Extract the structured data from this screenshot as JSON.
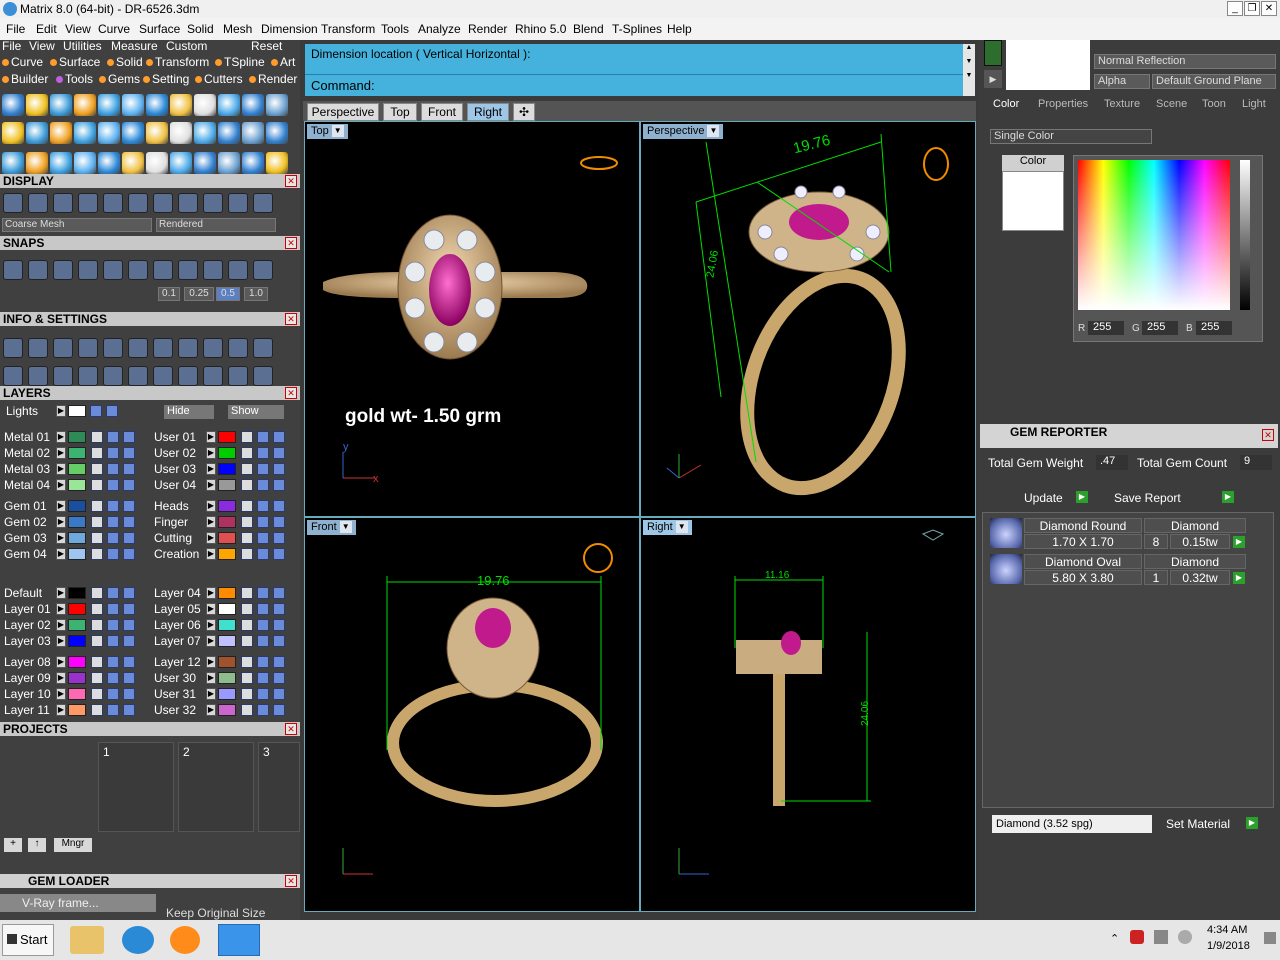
{
  "window": {
    "title": "Matrix 8.0 (64-bit) - DR-6526.3dm"
  },
  "menu": [
    "File",
    "Edit",
    "View",
    "Curve",
    "Surface",
    "Solid",
    "Mesh",
    "Dimension",
    "Transform",
    "Tools",
    "Analyze",
    "Render",
    "Rhino 5.0",
    "Blend",
    "T-Splines",
    "Help"
  ],
  "left_menu": {
    "items": [
      "File",
      "View",
      "Utilities",
      "Measure",
      "Custom"
    ],
    "reset": "Reset"
  },
  "builder_row1": [
    "Curve",
    "Surface",
    "Solid",
    "Transform",
    "TSpline",
    "Art"
  ],
  "builder_row2": [
    "Builder",
    "Tools",
    "Gems",
    "Setting",
    "Cutters",
    "Render"
  ],
  "colors": {
    "row1": [
      "#ff9c2c",
      "#ff9c2c",
      "#ff9c2c",
      "#ff9c2c",
      "#ff9c2c",
      "#ff9c2c"
    ],
    "row2": [
      "#ff9c2c",
      "#c060e0",
      "#ff9c2c",
      "#ff9c2c",
      "#ff9c2c",
      "#ff9c2c"
    ]
  },
  "display": {
    "header": "DISPLAY",
    "mesh": "Coarse Mesh",
    "render": "Rendered"
  },
  "snaps": {
    "header": "SNAPS",
    "values": [
      "0.1",
      "0.25",
      "0.5",
      "1.0"
    ]
  },
  "info": {
    "header": "INFO & SETTINGS"
  },
  "layers": {
    "header": "LAYERS",
    "lights": "Lights",
    "hide": "Hide",
    "show": "Show",
    "left1": [
      {
        "n": "Metal 01",
        "c": "#2e8b57"
      },
      {
        "n": "Metal 02",
        "c": "#3cb371"
      },
      {
        "n": "Metal 03",
        "c": "#66cc66"
      },
      {
        "n": "Metal 04",
        "c": "#99e699"
      }
    ],
    "right1": [
      {
        "n": "User 01",
        "c": "#ff0000"
      },
      {
        "n": "User 02",
        "c": "#00cc00"
      },
      {
        "n": "User 03",
        "c": "#0000ff"
      },
      {
        "n": "User 04",
        "c": "#999999"
      }
    ],
    "left2": [
      {
        "n": "Gem 01",
        "c": "#1a4fa0"
      },
      {
        "n": "Gem 02",
        "c": "#3a78c8"
      },
      {
        "n": "Gem 03",
        "c": "#6fa8dc"
      },
      {
        "n": "Gem 04",
        "c": "#9fc5f0"
      }
    ],
    "right2": [
      {
        "n": "Heads",
        "c": "#8a2be2"
      },
      {
        "n": "Finger",
        "c": "#b03060"
      },
      {
        "n": "Cutting",
        "c": "#e05050"
      },
      {
        "n": "Creation",
        "c": "#ffa500"
      }
    ],
    "left3": [
      {
        "n": "Default",
        "c": "#000000"
      },
      {
        "n": "Layer 01",
        "c": "#ff0000"
      },
      {
        "n": "Layer 02",
        "c": "#3cb371"
      },
      {
        "n": "Layer 03",
        "c": "#0000ff"
      }
    ],
    "right3": [
      {
        "n": "Layer 04",
        "c": "#ff8c00"
      },
      {
        "n": "Layer 05",
        "c": "#ffffff"
      },
      {
        "n": "Layer 06",
        "c": "#40e0d0"
      },
      {
        "n": "Layer 07",
        "c": "#c0c0ff"
      }
    ],
    "left4": [
      {
        "n": "Layer 08",
        "c": "#ff00ff"
      },
      {
        "n": "Layer 09",
        "c": "#9932cc"
      },
      {
        "n": "Layer 10",
        "c": "#ff69b4"
      },
      {
        "n": "Layer 11",
        "c": "#ff9966"
      }
    ],
    "right4": [
      {
        "n": "Layer 12",
        "c": "#a0522d"
      },
      {
        "n": "User 30",
        "c": "#8fbc8f"
      },
      {
        "n": "User 31",
        "c": "#9999ff"
      },
      {
        "n": "User 32",
        "c": "#cc66cc"
      }
    ]
  },
  "projects": {
    "header": "PROJECTS",
    "slots": [
      "1",
      "2",
      "3"
    ],
    "mngr": "Mngr"
  },
  "gem_loader": {
    "header": "GEM LOADER",
    "vray": "V-Ray frame...",
    "keep": "Keep Original Size"
  },
  "command": {
    "prompt": "Dimension location ( Vertical  Horizontal ):",
    "label": "Command:"
  },
  "view_tabs": [
    "Perspective",
    "Top",
    "Front",
    "Right"
  ],
  "viewports": {
    "top": {
      "label": "Top",
      "annotation": "gold wt- 1.50 grm"
    },
    "perspective": {
      "label": "Perspective",
      "dim1": "19.76",
      "dim2": "24.06"
    },
    "front": {
      "label": "Front",
      "dim1": "19.76"
    },
    "right": {
      "label": "Right",
      "dim1": "11.16",
      "dim2": "24.06"
    }
  },
  "right_panel": {
    "reflection": "Normal Reflection",
    "alpha": "Alpha",
    "ground": "Default Ground Plane",
    "tabs": [
      "Color",
      "Properties",
      "Texture",
      "Scene",
      "Toon",
      "Light"
    ],
    "single_color": "Single Color",
    "color_label": "Color",
    "rgb": {
      "r": "255",
      "g": "255",
      "b": "255"
    }
  },
  "gem_reporter": {
    "header": "GEM REPORTER",
    "weight_label": "Total Gem Weight",
    "weight": ".47",
    "count_label": "Total Gem Count",
    "count": "9",
    "update": "Update",
    "save": "Save Report",
    "rows": [
      {
        "name": "Diamond Round",
        "size": "1.70 X 1.70",
        "type": "Diamond",
        "qty": "8",
        "tw": "0.15tw"
      },
      {
        "name": "Diamond Oval",
        "size": "5.80 X 3.80",
        "type": "Diamond",
        "qty": "1",
        "tw": "0.32tw"
      }
    ],
    "material": "Diamond    (3.52 spg)",
    "set_material": "Set Material"
  },
  "taskbar": {
    "start": "Start",
    "time": "4:34 AM",
    "date": "1/9/2018"
  }
}
